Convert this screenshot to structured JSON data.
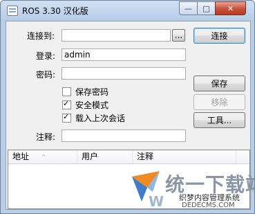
{
  "window": {
    "title": "ROS 3.30 汉化版",
    "minimize_glyph": "—",
    "maximize_glyph": "□",
    "close_glyph": "✕"
  },
  "form": {
    "connect_to_label": "连接到:",
    "connect_to_value": "",
    "browse_label": "...",
    "login_label": "登录:",
    "login_value": "admin",
    "password_label": "密码:",
    "password_value": "",
    "note_label": "注释:",
    "note_value": ""
  },
  "checkboxes": [
    {
      "label": "保存密码",
      "checked": false
    },
    {
      "label": "安全模式",
      "checked": true
    },
    {
      "label": "载入上次会话",
      "checked": true
    }
  ],
  "buttons": {
    "connect": "连接",
    "save": "保存",
    "remove": "移除",
    "tools": "工具..."
  },
  "table": {
    "columns": [
      "地址",
      "用户",
      "注释"
    ],
    "sort_glyph": "^",
    "rows": []
  },
  "watermark": {
    "title": "统一下载站",
    "subtitle": "织梦内容管理系统",
    "url": "DEDECMS.COM",
    "letter": "W"
  },
  "colors": {
    "title_bar": "#b7cde8",
    "close_button": "#c7503a",
    "default_button_border": "#3c7fb1"
  }
}
